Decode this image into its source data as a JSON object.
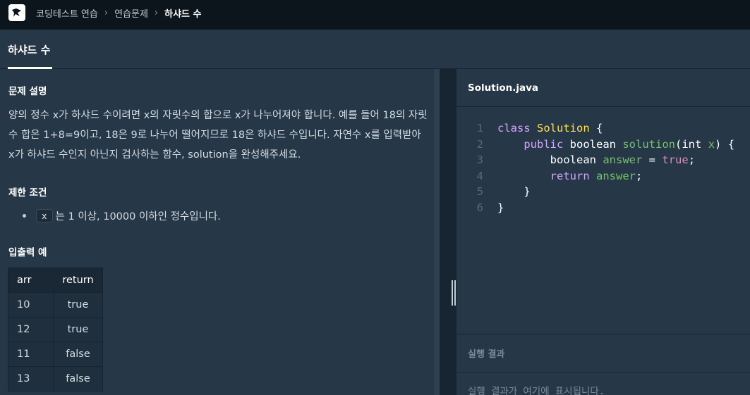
{
  "breadcrumb": {
    "items": [
      "코딩테스트 연습",
      "연습문제",
      "하샤드 수"
    ]
  },
  "tab": {
    "title": "하샤드 수"
  },
  "description": {
    "heading": "문제 설명",
    "paragraph": "양의 정수 x가 하샤드 수이려면 x의 자릿수의 합으로 x가 나누어져야 합니다. 예를 들어 18의 자릿수 합은 1+8=9이고, 18은 9로 나누어 떨어지므로 18은 하샤드 수입니다. 자연수 x를 입력받아 x가 하샤드 수인지 아닌지 검사하는 함수, solution을 완성해주세요.",
    "constraints_heading": "제한 조건",
    "constraint_code": "x",
    "constraint_text": "는 1 이상, 10000 이하인 정수입니다.",
    "io_heading": "입출력 예",
    "io_table": {
      "headers": [
        "arr",
        "return"
      ],
      "rows": [
        [
          "10",
          "true"
        ],
        [
          "12",
          "true"
        ],
        [
          "11",
          "false"
        ],
        [
          "13",
          "false"
        ]
      ]
    }
  },
  "editor": {
    "filename": "Solution.java",
    "line_numbers": [
      "1",
      "2",
      "3",
      "4",
      "5",
      "6"
    ],
    "tokens": {
      "class_kw": "class",
      "class_name": "Solution",
      "open_brace": "{",
      "public_kw": "public",
      "boolean_kw": "boolean",
      "method": "solution",
      "open_paren": "(",
      "int_kw": "int",
      "param": "x",
      "close_paren_brace": ") {",
      "var": "answer",
      "assign": "=",
      "true_lit": "true",
      "semicolon": ";",
      "return_kw": "return",
      "close_brace": "}"
    }
  },
  "result": {
    "heading": "실행 결과",
    "placeholder": "실행 결과가 여기에 표시됩니다."
  }
}
